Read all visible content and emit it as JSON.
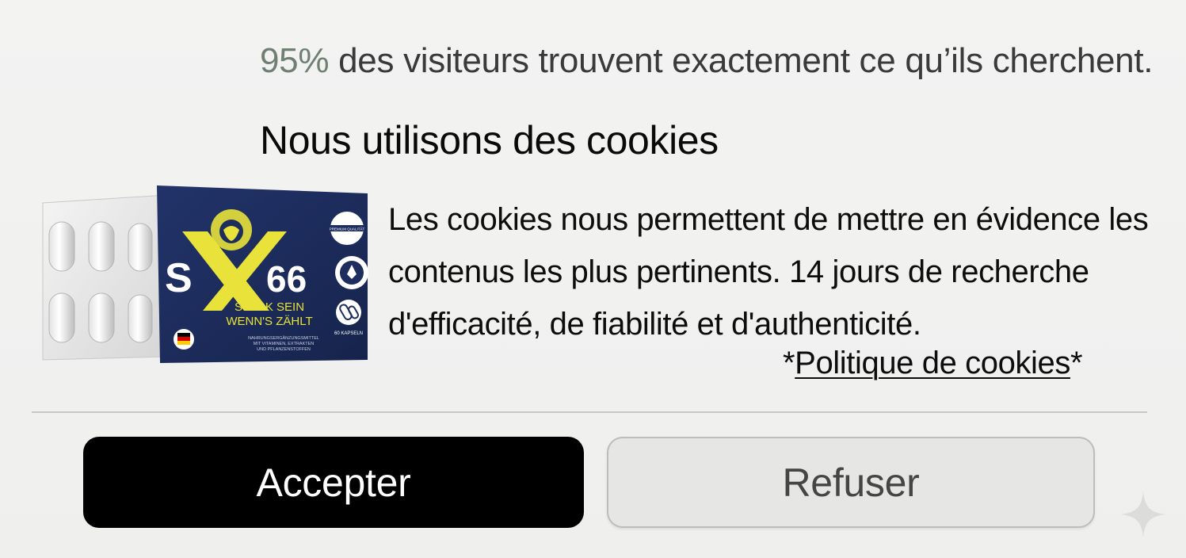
{
  "stat": {
    "percent": "95%",
    "text": " des visiteurs trouvent exactement ce qu’ils cherchent."
  },
  "heading": "Nous utilisons des cookies",
  "product": {
    "brand": "SX66",
    "tagline_1": "STARK SEIN",
    "tagline_2": "WENN'S ZÄHLT",
    "fine_print_1": "NAHRUNGSERGÄNZUNGSMITTEL",
    "fine_print_2": "MIT VITAMINEN, EXTRAKTEN",
    "fine_print_3": "UND PFLANZENSTOFFEN",
    "count": "60 KAPSELN",
    "badge_quality": "PREMIUM QUALITÄT",
    "colors": {
      "box": "#1c2d5e",
      "accent": "#e8e23a"
    }
  },
  "body": {
    "line1": "Les cookies nous permettent de mettre en évidence les",
    "line2": "contenus les plus pertinents. 14 jours de recherche",
    "line3": "d'efficacité, de fiabilité et d'authenticité."
  },
  "policy": {
    "prefix": "*",
    "link": "Politique de cookies",
    "suffix": "*"
  },
  "buttons": {
    "accept": "Accepter",
    "refuse": "Refuser"
  },
  "icons": {
    "sparkle": "sparkle-icon"
  }
}
